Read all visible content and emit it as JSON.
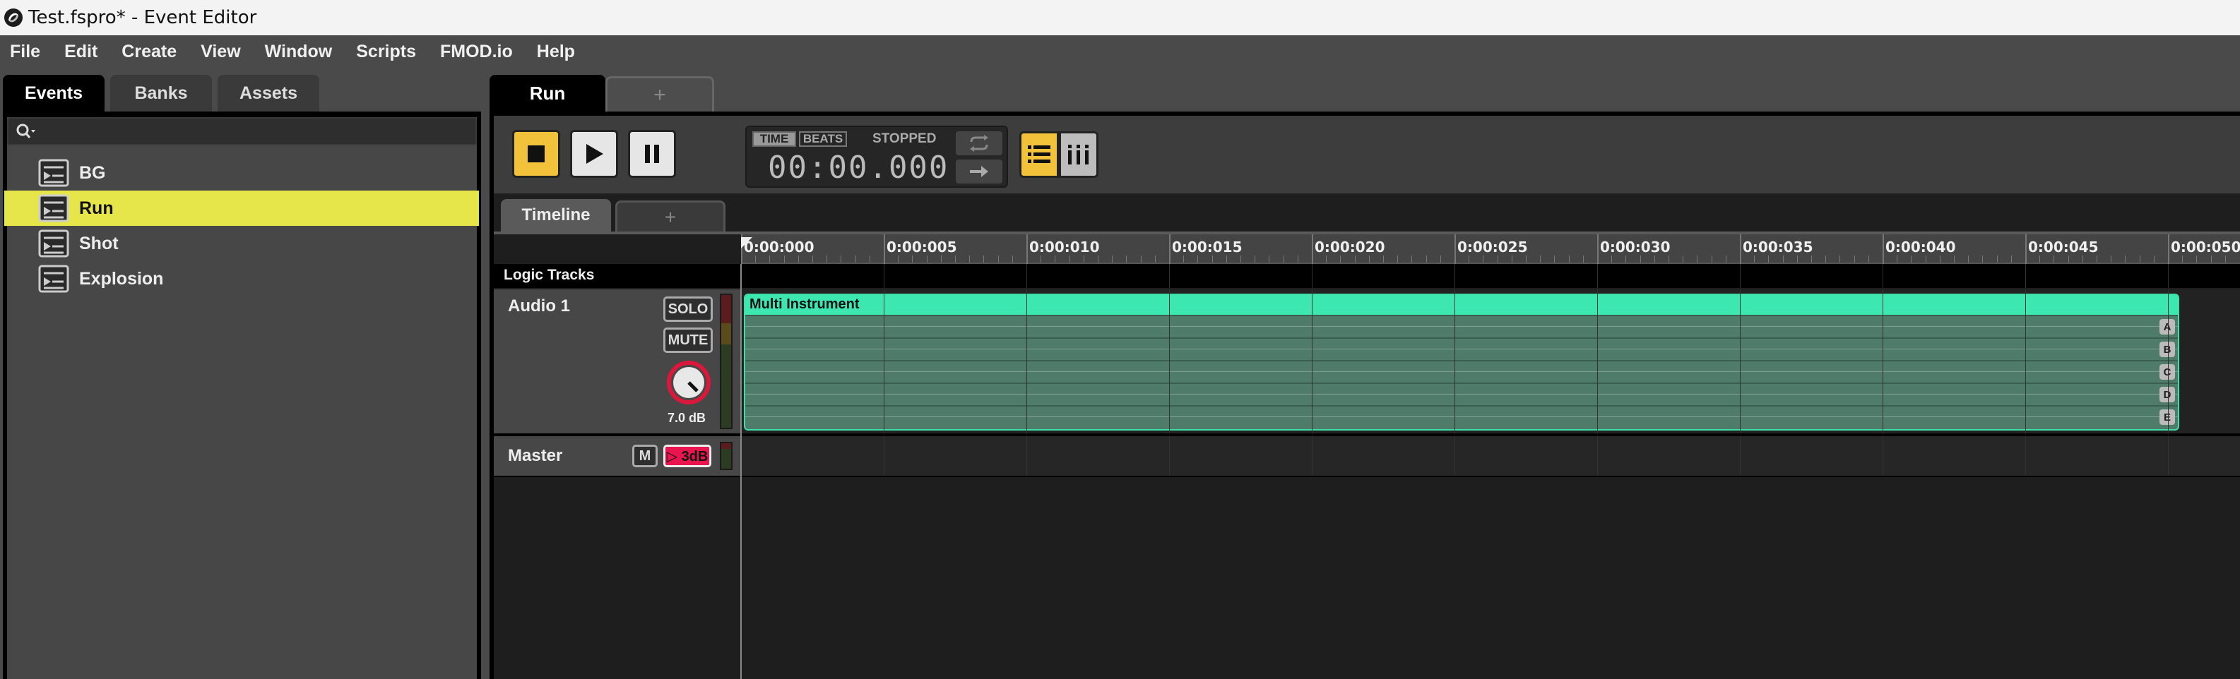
{
  "window": {
    "title": "Test.fspro* - Event Editor"
  },
  "menu": [
    "File",
    "Edit",
    "Create",
    "View",
    "Window",
    "Scripts",
    "FMOD.io",
    "Help"
  ],
  "browser": {
    "tabs": [
      "Events",
      "Banks",
      "Assets"
    ],
    "active_tab": "Events",
    "search": {
      "value": "",
      "placeholder": ""
    },
    "events": [
      {
        "label": "BG",
        "selected": false
      },
      {
        "label": "Run",
        "selected": true
      },
      {
        "label": "Shot",
        "selected": false
      },
      {
        "label": "Explosion",
        "selected": false
      }
    ]
  },
  "editor": {
    "event_tab": "Run",
    "add_tab_label": "+",
    "transport": {
      "mode_time": "TIME",
      "mode_beats": "BEATS",
      "state": "STOPPED",
      "timecode": "00:00.000",
      "active_mode": "TIME"
    },
    "timeline_tab": "Timeline",
    "timeline_add_label": "+",
    "ruler_ticks": [
      "0:00:000",
      "0:00:005",
      "0:00:010",
      "0:00:015",
      "0:00:020",
      "0:00:025",
      "0:00:030",
      "0:00:035",
      "0:00:040",
      "0:00:045",
      "0:00:050"
    ],
    "logic_tracks_label": "Logic Tracks",
    "audio_track": {
      "name": "Audio 1",
      "solo_label": "SOLO",
      "mute_label": "MUTE",
      "volume_label": "7.0 dB",
      "instrument": {
        "title": "Multi Instrument",
        "layers": [
          "A",
          "B",
          "C",
          "D",
          "E"
        ]
      }
    },
    "master_track": {
      "name": "Master",
      "mute_label": "M",
      "send_label": "▷ 3dB"
    }
  },
  "colors": {
    "accent_yellow": "#f2c33a",
    "selection_yellow": "#e6e64a",
    "instrument_green": "#3de8b0",
    "knob_red": "#d9183b",
    "send_pink": "#e8154f"
  },
  "icons": {
    "app": "fmod-logo-icon",
    "search": "search-icon",
    "event": "event-icon",
    "stop": "stop-icon",
    "play": "play-icon",
    "pause": "pause-icon",
    "loop": "loop-icon",
    "follow": "follow-arrow-icon",
    "list_view": "list-view-icon",
    "grid_view": "grid-view-icon",
    "volume_knob": "knob-icon"
  }
}
